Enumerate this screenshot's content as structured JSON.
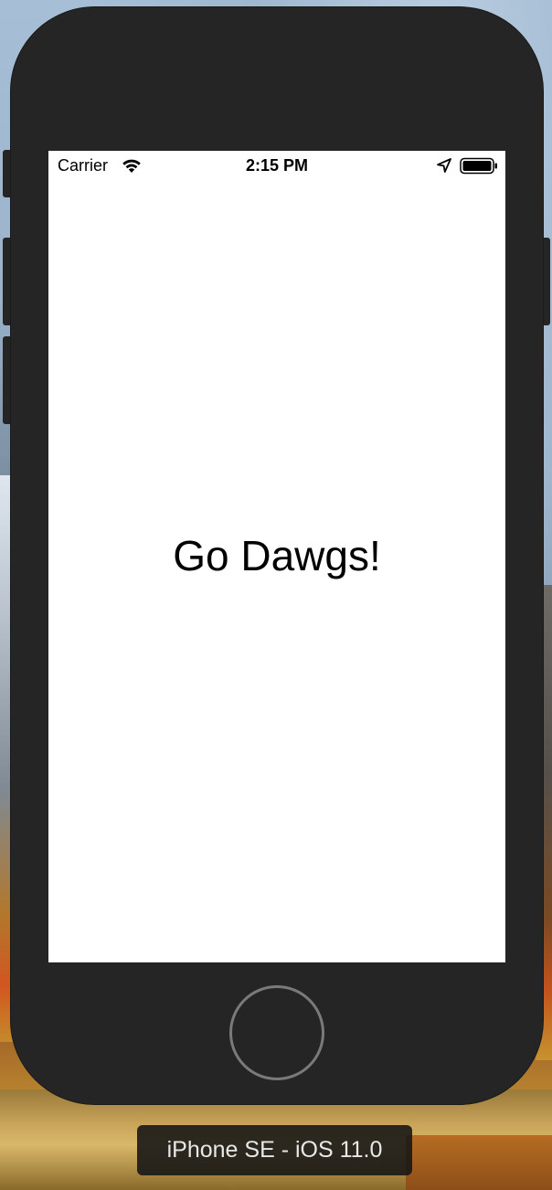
{
  "status_bar": {
    "carrier": "Carrier",
    "time": "2:15 PM",
    "wifi_icon": "wifi-icon",
    "location_icon": "location-arrow-icon",
    "battery_icon": "battery-full-icon"
  },
  "screen": {
    "label": "Go Dawgs!",
    "background_color": "#ffffff",
    "text_color": "#000000"
  },
  "device": {
    "name": "iPhone SE - iOS 11.0",
    "body_color": "#252525"
  }
}
